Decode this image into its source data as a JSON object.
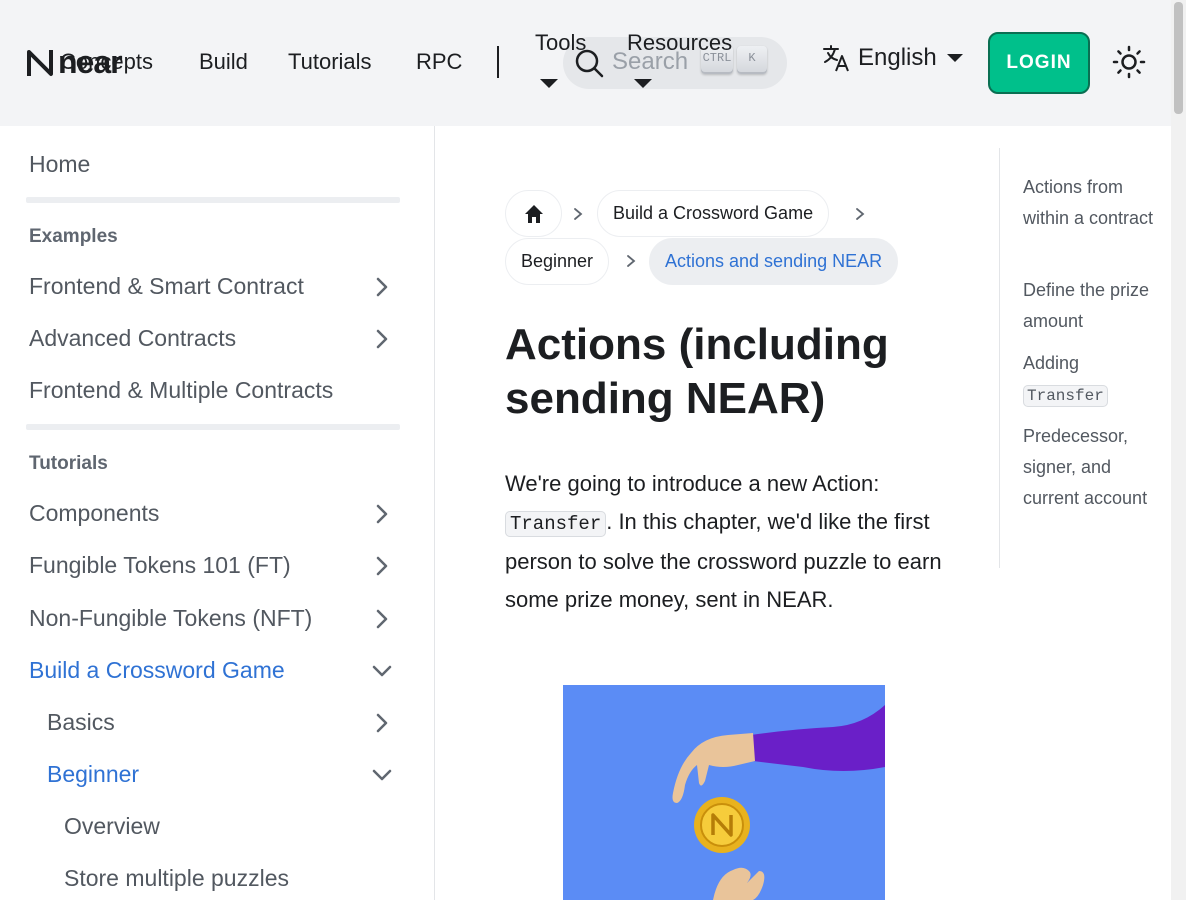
{
  "navbar": {
    "logo_text": "near",
    "links": [
      "Concepts",
      "Build",
      "Tutorials",
      "RPC"
    ],
    "tools_label": "Tools",
    "resources_label": "Resources",
    "search_placeholder": "Search",
    "kbd_ctrl": "CTRL",
    "kbd_k": "K",
    "language": "English",
    "login_label": "LOGIN"
  },
  "sidebar": {
    "home": "Home",
    "examples_heading": "Examples",
    "examples": [
      "Frontend & Smart Contract",
      "Advanced Contracts",
      "Frontend & Multiple Contracts"
    ],
    "tutorials_heading": "Tutorials",
    "tutorials": [
      "Components",
      "Fungible Tokens 101 (FT)",
      "Non-Fungible Tokens (NFT)",
      "Build a Crossword Game"
    ],
    "crossword_children": [
      "Basics",
      "Beginner"
    ],
    "beginner_children": [
      "Overview",
      "Store multiple puzzles"
    ]
  },
  "breadcrumb": {
    "items": [
      "Build a Crossword Game",
      "Beginner",
      "Actions and sending NEAR"
    ]
  },
  "article": {
    "title": "Actions (including sending NEAR)",
    "para_before": "We're going to introduce a new Action: ",
    "para_code": "Transfer",
    "para_after": ". In this chapter, we'd like the first person to solve the crossword puzzle to earn some prize money, sent in NEAR."
  },
  "toc": {
    "item1": "Actions from within a contract",
    "item2": "Define the prize amount",
    "item3_prefix": "Adding",
    "item3_code": "Transfer",
    "item4": "Predecessor, signer, and current account"
  },
  "colors": {
    "accent": "#2f72d4",
    "login_bg": "#00c08b",
    "hero_bg": "#5b8cf5"
  },
  "icons": [
    "near-logo-icon",
    "search-icon",
    "translate-icon",
    "caret-down-icon",
    "sun-icon",
    "home-icon",
    "chevron-right-icon",
    "chevron-down-icon"
  ]
}
